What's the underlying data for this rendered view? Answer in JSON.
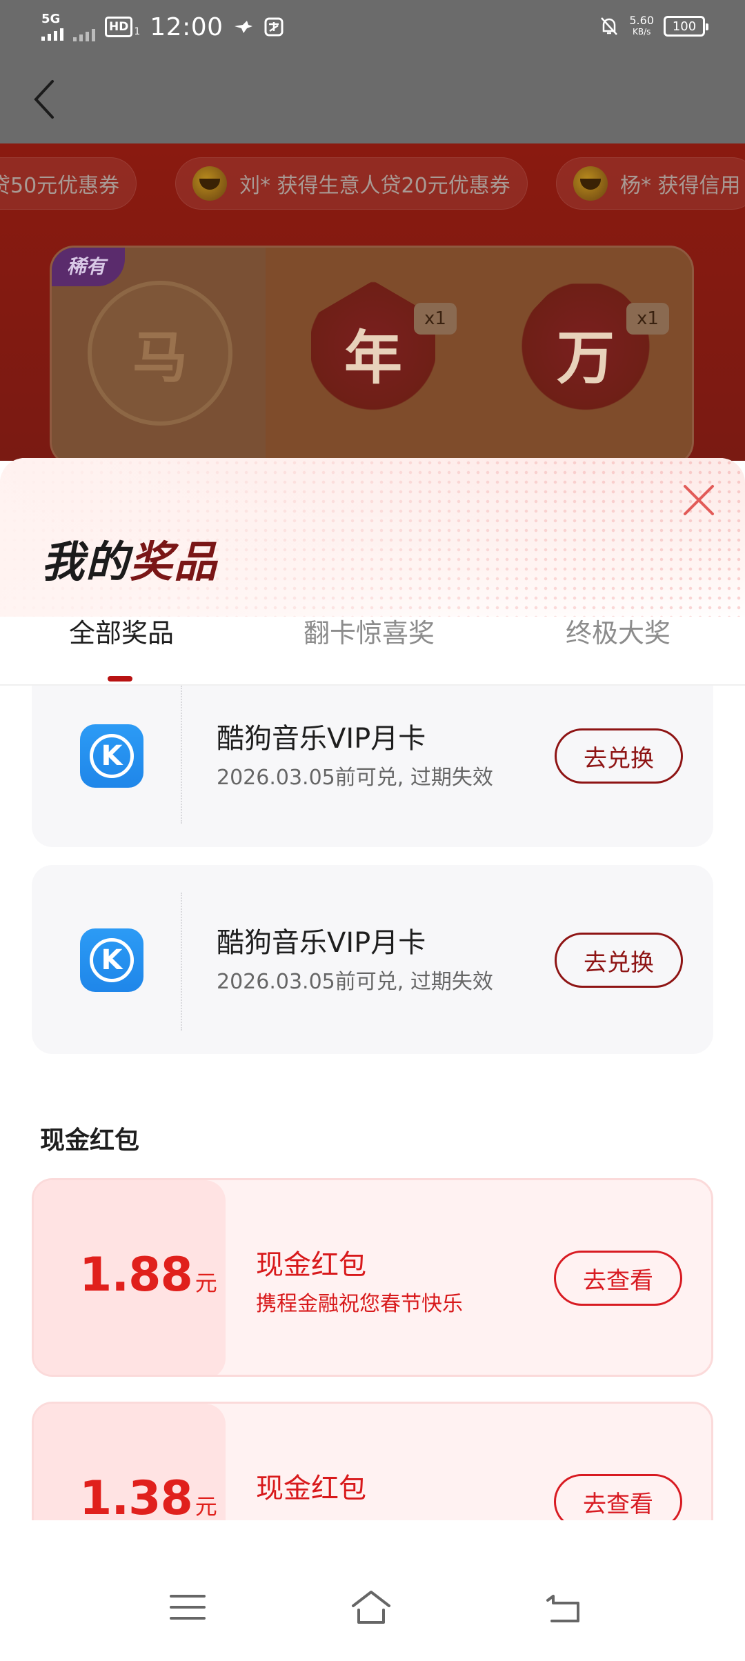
{
  "status_bar": {
    "network": "5G",
    "hd_label": "HD",
    "hd_sub": "1",
    "time": "12:00",
    "net_speed_value": "5.60",
    "net_speed_unit": "KB/s",
    "battery": "100"
  },
  "ticker": [
    "贷50元优惠券",
    "刘* 获得生意人贷20元优惠券",
    "杨* 获得信用"
  ],
  "cards_strip": {
    "rare_tag": "稀有",
    "cards": [
      {
        "char": "马"
      },
      {
        "char": "年",
        "count": "x1"
      },
      {
        "char": "万",
        "count": "x1"
      }
    ]
  },
  "sheet": {
    "title_black": "我的",
    "title_red": "奖品",
    "tabs": [
      "全部奖品",
      "翻卡惊喜奖",
      "终极大奖"
    ],
    "active_tab_index": 0
  },
  "prizes": [
    {
      "name": "酷狗音乐VIP月卡",
      "expiry": "2026.03.05前可兑, 过期失效",
      "action": "去兑换",
      "icon": "kugou-icon",
      "icon_letter": "K"
    },
    {
      "name": "酷狗音乐VIP月卡",
      "expiry": "2026.03.05前可兑, 过期失效",
      "action": "去兑换",
      "icon": "kugou-icon",
      "icon_letter": "K"
    }
  ],
  "cash_section": {
    "title": "现金红包",
    "items": [
      {
        "amount": "1.88",
        "unit": "元",
        "name": "现金红包",
        "desc": "携程金融祝您春节快乐",
        "action": "去查看"
      },
      {
        "amount": "1.38",
        "unit": "元",
        "name": "现金红包",
        "desc": "",
        "action": "去查看"
      }
    ]
  },
  "colors": {
    "accent_dark_red": "#8e1414",
    "cash_red": "#d8191b",
    "kugou_blue": "#1f86e9"
  }
}
